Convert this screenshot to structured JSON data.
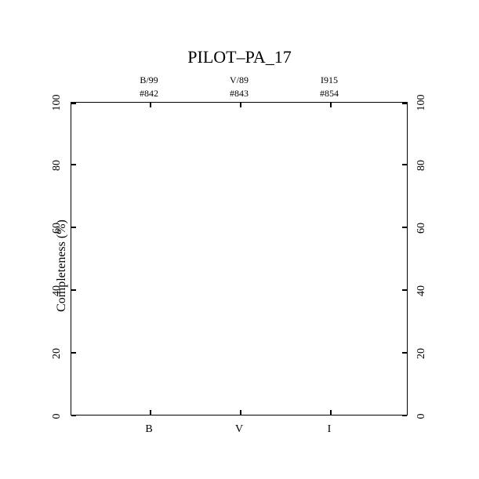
{
  "chart_data": {
    "type": "bar",
    "title": "PILOT–PA_17",
    "ylabel": "Completeness (%)",
    "ylim": [
      0,
      100
    ],
    "yticks": [
      0,
      20,
      40,
      60,
      80,
      100
    ],
    "categories": [
      "B",
      "V",
      "I"
    ],
    "values": [
      null,
      null,
      null
    ],
    "top_annotations_line1": [
      "B/99",
      "V/89",
      "I915"
    ],
    "top_annotations_line2": [
      "#842",
      "#843",
      "#854"
    ]
  }
}
